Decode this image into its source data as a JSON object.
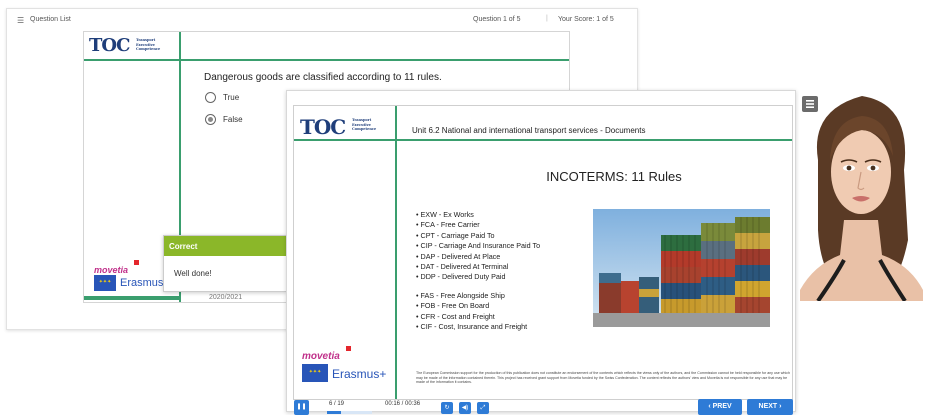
{
  "quiz": {
    "topbar": {
      "question_list_label": "Question List",
      "progress": "Question 1 of 5",
      "separator": "|",
      "score": "Your Score: 1 of 5"
    },
    "question": "Dangerous goods are classified according to 11 rules.",
    "options": [
      "True",
      "False"
    ],
    "selected_option": "False",
    "year": "2020/2021",
    "feedback": {
      "header": "Correct",
      "message": "Well done!",
      "header_color": "#8bb729"
    }
  },
  "logo": {
    "main": "TOC",
    "lines": [
      "Transport",
      "Executive",
      "Competence"
    ]
  },
  "sponsors": {
    "movetia": "movetia",
    "erasmus": "Erasmus+"
  },
  "slide": {
    "unit_title": "Unit 6.2 National and international transport services - Documents",
    "title": "INCOTERMS: 11 Rules",
    "rules_group1": [
      "• EXW  - Ex Works",
      "• FCA - Free Carrier",
      "• CPT - Carriage Paid To",
      "• CIP - Carriage And Insurance Paid To",
      "• DAP - Delivered At Place",
      "• DAT - Delivered At Terminal",
      "• DDP - Delivered Duty Paid"
    ],
    "rules_group2": [
      "• FAS - Free Alongside Ship",
      "• FOB - Free On Board",
      "• CFR - Cost and Freight",
      "• CIF - Cost, Insurance and Freight"
    ],
    "disclaimer": "The European Commission support for the production of this publication does not constitute an endorsement of the contents which reflects the views only of the authors, and the Commission cannot be held responsible for any use which may be made of the information contained therein. This project has received grant support from Movetia funded by the Swiss Confederation. The content reflects the authors' view and Movetia is not responsible for any use that may be made of the information it contains."
  },
  "player": {
    "slide_counter": "6 / 19",
    "progress_fraction": 0.32,
    "time": "00:16 / 00:36",
    "prev_label": "PREV",
    "next_label": "NEXT",
    "accent_color": "#2e7bd6"
  },
  "icons": {
    "question_list": "list-icon",
    "pause": "pause-icon",
    "replay": "replay-icon",
    "volume": "volume-icon",
    "fullscreen": "fullscreen-icon",
    "avatar_toggle": "swap-icon"
  }
}
